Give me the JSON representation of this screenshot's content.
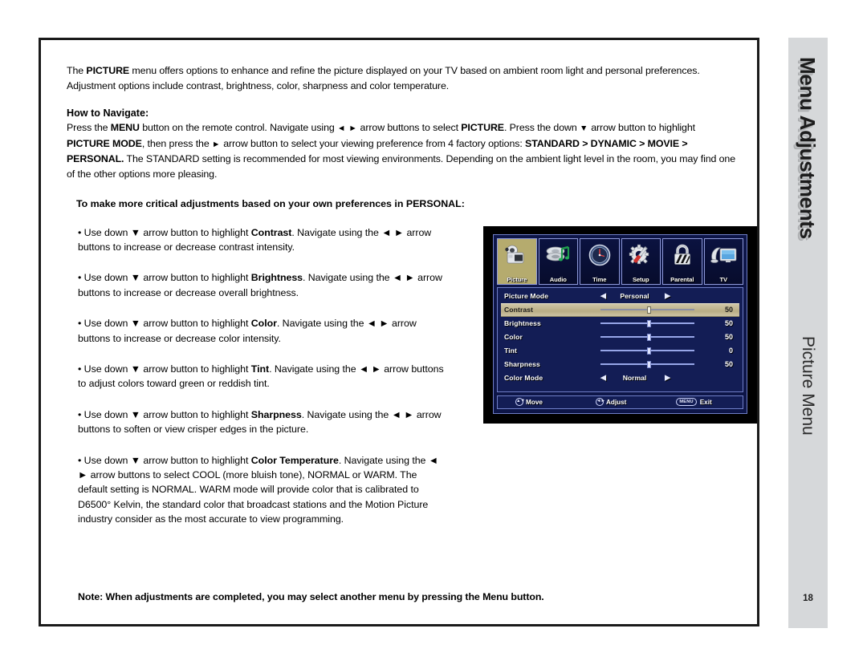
{
  "document": {
    "intro": {
      "part1": "The ",
      "bold1": "PICTURE",
      "part2": " menu offers options to enhance and refine the picture displayed on your TV based on ambient room light and personal preferences. Adjustment options include contrast, brightness, color, sharpness and color temperature."
    },
    "navigate_heading": "How to Navigate:",
    "navigate": {
      "p1a": "Press the ",
      "b1": "MENU",
      "p1b": " button on the remote control. Navigate using ",
      "arrows_lr": "◄ ►",
      "p1c": " arrow buttons to select ",
      "b2": "PICTURE",
      "p1d": ". Press the down ",
      "arrow_down": "▼",
      "p1e": " arrow button to highlight ",
      "b3": "PICTURE MODE",
      "p1f": ", then press the ",
      "arrow_right": "►",
      "p1g": " arrow button to select your viewing preference from 4 factory options:",
      "b4": "STANDARD > DYNAMIC > MOVIE > PERSONAL.",
      "p1h": " The STANDARD setting is recommended for most viewing environments. Depending on the ambient light level in the room, you may find one of the other options more pleasing."
    },
    "personal_heading": "To make more critical adjustments based on your own preferences in PERSONAL:",
    "bullets": [
      {
        "lead": "• Use down ▼ arrow button to highlight ",
        "term": "Contrast",
        "tail": ". Navigate using the ◄ ► arrow buttons to increase or decrease contrast intensity."
      },
      {
        "lead": "• Use down ▼ arrow button to highlight ",
        "term": "Brightness",
        "tail": ". Navigate using the ◄ ► arrow buttons to increase or decrease overall brightness."
      },
      {
        "lead": "• Use down ▼ arrow button to highlight ",
        "term": "Color",
        "tail": ". Navigate using the ◄ ► arrow buttons to increase or decrease color intensity."
      },
      {
        "lead": "• Use down ▼ arrow button to highlight ",
        "term": "Tint",
        "tail": ". Navigate using the ◄ ► arrow buttons to adjust colors toward green or reddish tint."
      },
      {
        "lead": "• Use down ▼ arrow button to highlight ",
        "term": "Sharpness",
        "tail": ". Navigate using the ◄ ► arrow buttons to soften or view crisper edges in the picture."
      },
      {
        "lead": "• Use down ▼ arrow button to highlight ",
        "term": "Color Temperature",
        "tail": ". Navigate using the ◄ ► arrow buttons to select COOL (more bluish tone), NORMAL or WARM. The default setting is NORMAL. WARM mode will provide color that is calibrated to D6500° Kelvin, the standard color that broadcast stations and the Motion Picture industry consider as the most accurate to view programming."
      }
    ],
    "note": "Note: When adjustments are completed, you may select another menu by pressing the Menu button."
  },
  "side_tab": {
    "title": "Menu Adjustments",
    "subtitle": "Picture Menu",
    "page_number": "18",
    "background_color": "#d6d8da"
  },
  "osd": {
    "background_color": "#131d55",
    "highlight_color": "#c3b995",
    "border_color": "#6f7ec6",
    "tabs": [
      {
        "label": "Picture",
        "icon": "camcorder-icon",
        "active": true
      },
      {
        "label": "Audio",
        "icon": "speaker-note-icon",
        "active": false
      },
      {
        "label": "Time",
        "icon": "clock-icon",
        "active": false
      },
      {
        "label": "Setup",
        "icon": "gear-screwdriver-icon",
        "active": false
      },
      {
        "label": "Parental",
        "icon": "padlock-icon",
        "active": false
      },
      {
        "label": "TV",
        "icon": "tv-antenna-icon",
        "active": false
      }
    ],
    "rows": [
      {
        "label": "Picture Mode",
        "type": "option",
        "value": "Personal",
        "highlight": false
      },
      {
        "label": "Contrast",
        "type": "slider",
        "value": "50",
        "percent": 50,
        "highlight": true
      },
      {
        "label": "Brightness",
        "type": "slider",
        "value": "50",
        "percent": 50,
        "highlight": false
      },
      {
        "label": "Color",
        "type": "slider",
        "value": "50",
        "percent": 50,
        "highlight": false
      },
      {
        "label": "Tint",
        "type": "slider",
        "value": "0",
        "percent": 50,
        "highlight": false
      },
      {
        "label": "Sharpness",
        "type": "slider",
        "value": "50",
        "percent": 50,
        "highlight": false
      },
      {
        "label": "Color Mode",
        "type": "option",
        "value": "Normal",
        "highlight": false
      }
    ],
    "hints": [
      {
        "keys": "▲▼",
        "label": "Move"
      },
      {
        "keys": "◄►",
        "label": "Adjust"
      },
      {
        "keys": "MENU",
        "label": "Exit"
      }
    ],
    "arrow_left": "◀",
    "arrow_right": "▶"
  }
}
